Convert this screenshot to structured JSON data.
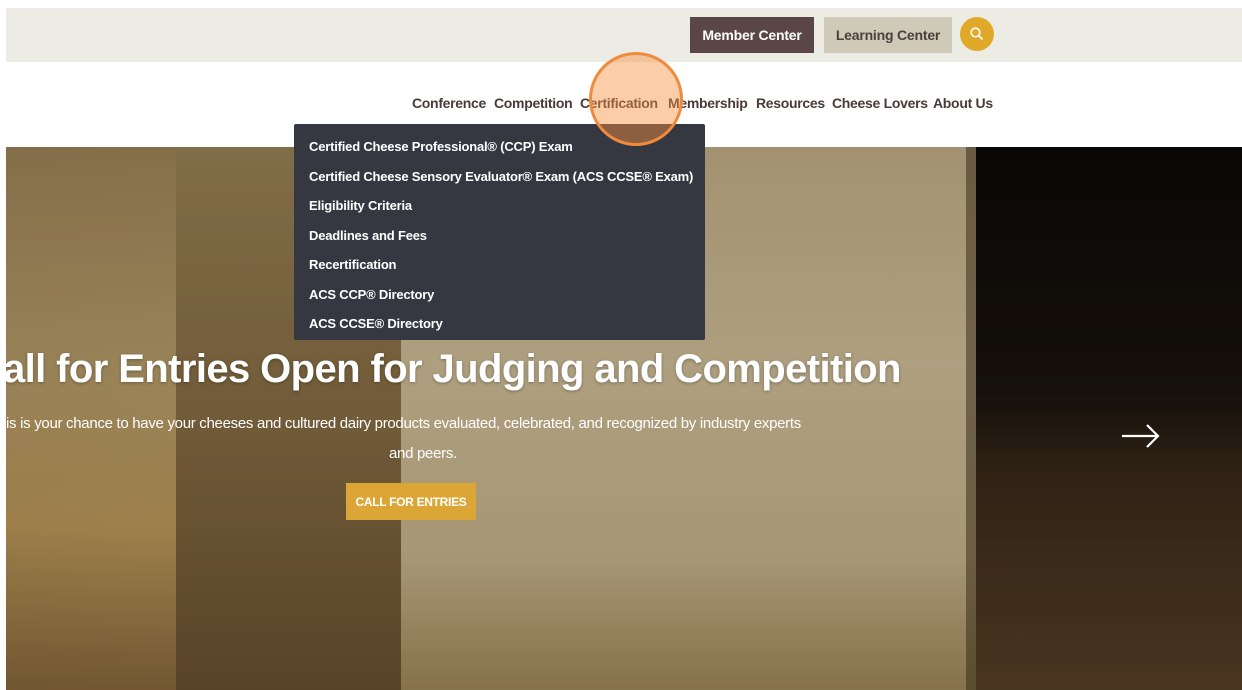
{
  "utility": {
    "member_center": "Member Center",
    "learning_center": "Learning Center"
  },
  "nav": {
    "items": [
      "Conference",
      "Competition",
      "Certification",
      "Membership",
      "Resources",
      "Cheese Lovers",
      "About Us"
    ]
  },
  "dropdown": {
    "items": [
      "Certified Cheese Professional® (CCP) Exam",
      "Certified Cheese Sensory Evaluator® Exam (ACS CCSE® Exam)",
      "Eligibility Criteria",
      "Deadlines and Fees",
      "Recertification",
      "ACS CCP® Directory",
      "ACS CCSE® Directory"
    ]
  },
  "hero": {
    "title": "all for Entries Open for Judging and Competition",
    "subtitle_line1": "is is your chance to have your cheeses and cultured dairy products evaluated, celebrated, and recognized by industry experts",
    "subtitle_line2": "and peers.",
    "cta": "CALL FOR ENTRIES"
  },
  "icons": {
    "search": "search-icon",
    "next": "arrow-right-icon"
  },
  "colors": {
    "member_button": "#5a4745",
    "learning_button": "#cfc9b7",
    "accent": "#dca637",
    "dropdown_bg": "#363841"
  }
}
